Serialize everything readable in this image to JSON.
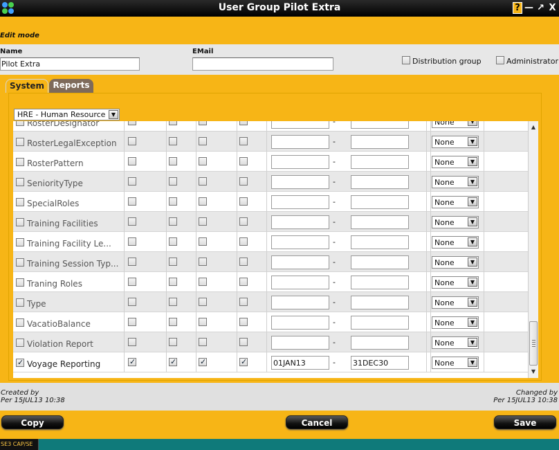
{
  "window": {
    "title": "User Group Pilot Extra",
    "help_label": "?",
    "minimize_label": "—",
    "maximize_label": "↗",
    "close_label": "X"
  },
  "mode_label": "Edit mode",
  "form": {
    "name_label": "Name",
    "name_value": "Pilot Extra",
    "email_label": "EMail",
    "email_value": "",
    "distribution_label": "Distribution group",
    "distribution_checked": false,
    "administrator_label": "Administrator",
    "administrator_checked": false
  },
  "tabs": [
    {
      "label": "System",
      "active": true
    },
    {
      "label": "Reports",
      "active": false
    }
  ],
  "module_select": {
    "value": "HRE - Human Resource"
  },
  "rows": [
    {
      "name": "RosterDesignator",
      "checked": false,
      "perms": [
        false,
        false,
        false,
        false
      ],
      "from": "",
      "to": "",
      "access": "None",
      "partial": true
    },
    {
      "name": "RosterLegalException",
      "checked": false,
      "perms": [
        false,
        false,
        false,
        false
      ],
      "from": "",
      "to": "",
      "access": "None"
    },
    {
      "name": "RosterPattern",
      "checked": false,
      "perms": [
        false,
        false,
        false,
        false
      ],
      "from": "",
      "to": "",
      "access": "None"
    },
    {
      "name": "SeniorityType",
      "checked": false,
      "perms": [
        false,
        false,
        false,
        false
      ],
      "from": "",
      "to": "",
      "access": "None"
    },
    {
      "name": "SpecialRoles",
      "checked": false,
      "perms": [
        false,
        false,
        false,
        false
      ],
      "from": "",
      "to": "",
      "access": "None"
    },
    {
      "name": "Training Facilities",
      "checked": false,
      "perms": [
        false,
        false,
        false,
        false
      ],
      "from": "",
      "to": "",
      "access": "None"
    },
    {
      "name": "Training Facility Le...",
      "checked": false,
      "perms": [
        false,
        false,
        false,
        false
      ],
      "from": "",
      "to": "",
      "access": "None"
    },
    {
      "name": "Training Session Typ...",
      "checked": false,
      "perms": [
        false,
        false,
        false,
        false
      ],
      "from": "",
      "to": "",
      "access": "None"
    },
    {
      "name": "Traning Roles",
      "checked": false,
      "perms": [
        false,
        false,
        false,
        false
      ],
      "from": "",
      "to": "",
      "access": "None"
    },
    {
      "name": "Type",
      "checked": false,
      "perms": [
        false,
        false,
        false,
        false
      ],
      "from": "",
      "to": "",
      "access": "None"
    },
    {
      "name": "VacatioBalance",
      "checked": false,
      "perms": [
        false,
        false,
        false,
        false
      ],
      "from": "",
      "to": "",
      "access": "None"
    },
    {
      "name": "Violation Report",
      "checked": false,
      "perms": [
        false,
        false,
        false,
        false
      ],
      "from": "",
      "to": "",
      "access": "None"
    },
    {
      "name": "Voyage Reporting",
      "checked": true,
      "perms": [
        true,
        true,
        true,
        true
      ],
      "from": "01JAN13",
      "to": "31DEC30",
      "access": "None"
    }
  ],
  "range_separator": "-",
  "meta": {
    "created_label": "Created by",
    "created_value": "Per 15JUL13 10:38",
    "changed_label": "Changed by",
    "changed_value": "Per 15JUL13 10:38"
  },
  "buttons": {
    "copy": "Copy",
    "cancel": "Cancel",
    "save": "Save"
  },
  "taskbar_label": "SE3 CAP/SE",
  "colors": {
    "accent": "#f7b516",
    "titlebar": "#000000",
    "desktop": "#0f7a7a"
  }
}
